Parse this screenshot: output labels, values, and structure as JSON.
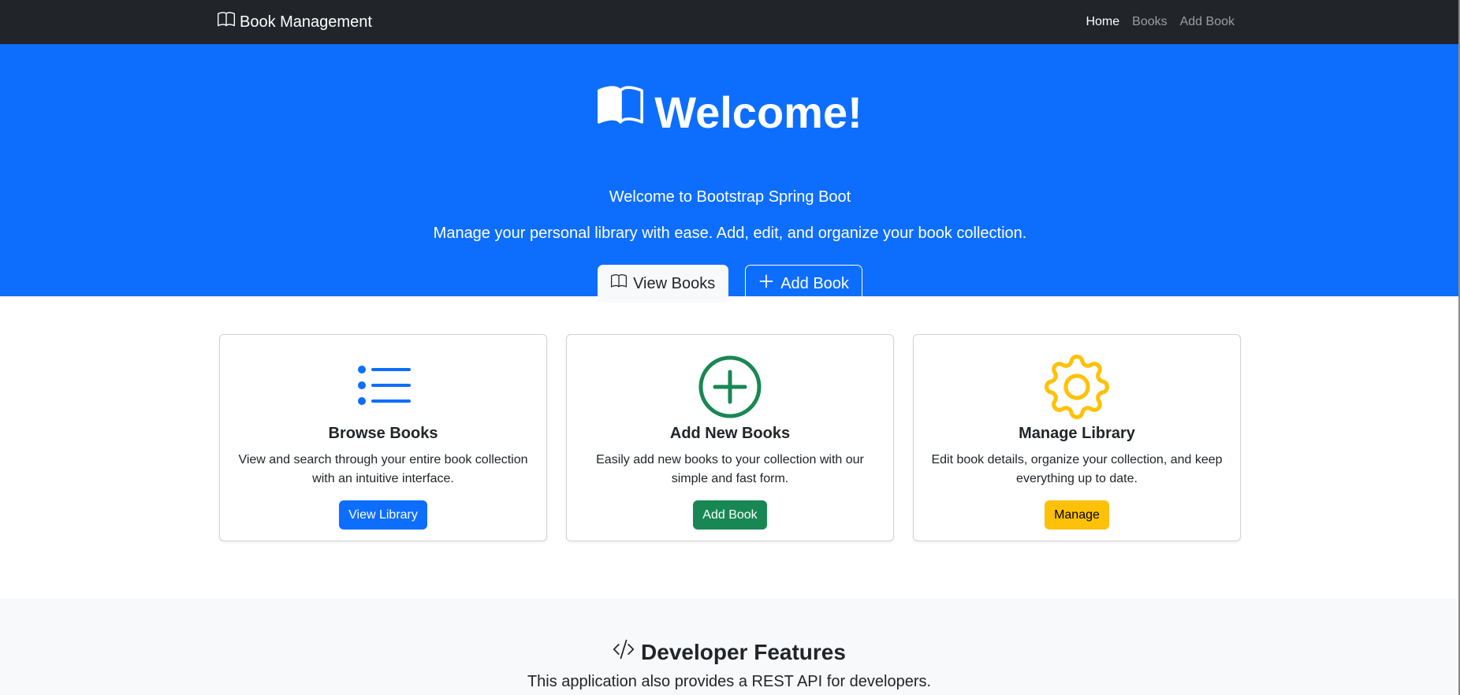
{
  "navbar": {
    "brand": "Book Management",
    "brand_icon": "book-icon",
    "links": [
      {
        "label": "Home",
        "active": true
      },
      {
        "label": "Books",
        "active": false
      },
      {
        "label": "Add Book",
        "active": false
      }
    ]
  },
  "hero": {
    "title": "Welcome!",
    "title_icon": "book-icon",
    "lead": "Welcome to Bootstrap Spring Boot",
    "description": "Manage your personal library with ease. Add, edit, and organize your book collection.",
    "buttons": {
      "view_books": {
        "label": "View Books",
        "icon": "book-icon"
      },
      "add_book": {
        "label": "Add Book",
        "icon": "plus-icon"
      }
    },
    "background_color": "#0d6efd"
  },
  "cards": [
    {
      "icon": "list-icon",
      "icon_color": "#0d6efd",
      "title": "Browse Books",
      "text": "View and search through your entire book collection with an intuitive interface.",
      "button": "View Library",
      "button_color": "#0d6efd"
    },
    {
      "icon": "plus-circle-icon",
      "icon_color": "#198754",
      "title": "Add New Books",
      "text": "Easily add new books to your collection with our simple and fast form.",
      "button": "Add Book",
      "button_color": "#198754"
    },
    {
      "icon": "gear-icon",
      "icon_color": "#ffc107",
      "title": "Manage Library",
      "text": "Edit book details, organize your collection, and keep everything up to date.",
      "button": "Manage",
      "button_color": "#ffc107"
    }
  ],
  "developer": {
    "title": "Developer Features",
    "title_icon": "code-icon",
    "lead": "This application also provides a REST API for developers."
  }
}
